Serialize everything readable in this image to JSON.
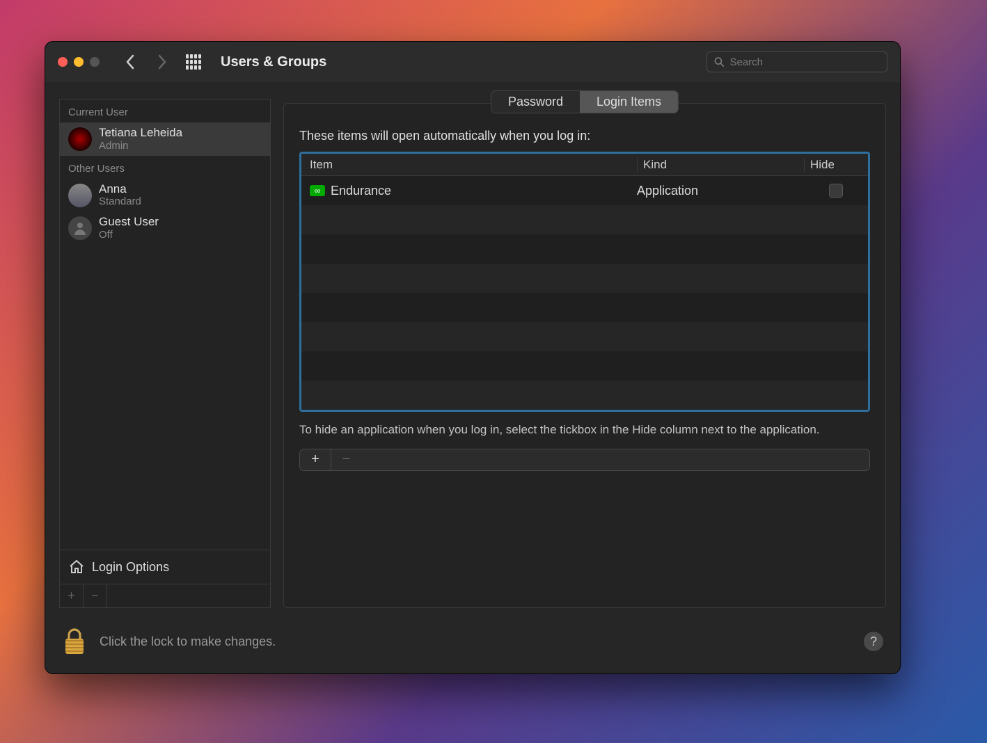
{
  "window": {
    "title": "Users & Groups"
  },
  "search": {
    "placeholder": "Search"
  },
  "sidebar": {
    "current_user_label": "Current User",
    "other_users_label": "Other Users",
    "current_user": {
      "name": "Tetiana Leheida",
      "role": "Admin"
    },
    "other_users": [
      {
        "name": "Anna",
        "role": "Standard"
      },
      {
        "name": "Guest User",
        "role": "Off"
      }
    ],
    "login_options_label": "Login Options"
  },
  "tabs": {
    "password": "Password",
    "login_items": "Login Items",
    "active": "login_items"
  },
  "panel": {
    "intro": "These items will open automatically when you log in:",
    "columns": {
      "item": "Item",
      "kind": "Kind",
      "hide": "Hide"
    },
    "rows": [
      {
        "name": "Endurance",
        "kind": "Application",
        "hide": false,
        "icon": "infinity"
      }
    ],
    "hint": "To hide an application when you log in, select the tickbox in the Hide column next to the application."
  },
  "lockbar": {
    "text": "Click the lock to make changes."
  }
}
